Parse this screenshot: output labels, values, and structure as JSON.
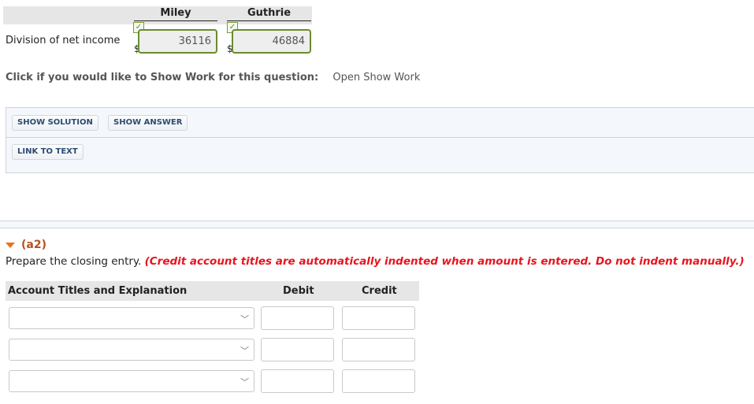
{
  "division": {
    "row_label": "Division of net income",
    "columns": [
      {
        "name": "Miley",
        "currency": "$",
        "value": "36116",
        "status": "correct"
      },
      {
        "name": "Guthrie",
        "currency": "$",
        "value": "46884",
        "status": "correct"
      }
    ],
    "check_glyph": "✓"
  },
  "show_work": {
    "question": "Click if you would like to Show Work for this question:",
    "link": "Open Show Work"
  },
  "solution_panel": {
    "show_solution": "SHOW SOLUTION",
    "show_answer": "SHOW ANSWER",
    "link_to_text": "LINK TO TEXT"
  },
  "part_a2": {
    "label": "(a2)",
    "instruction": "Prepare the closing entry.",
    "instruction_note": "(Credit account titles are automatically indented when amount is entered. Do not indent manually.)",
    "table": {
      "headers": [
        "Account Titles and Explanation",
        "Debit",
        "Credit"
      ],
      "rows": [
        {
          "account": "",
          "debit": "",
          "credit": ""
        },
        {
          "account": "",
          "debit": "",
          "credit": ""
        },
        {
          "account": "",
          "debit": "",
          "credit": ""
        }
      ]
    }
  },
  "colors": {
    "correct_border": "#6a8c2f",
    "part_label": "#b5501f",
    "warning_text": "#e8141e",
    "button_text": "#2c4b72"
  }
}
